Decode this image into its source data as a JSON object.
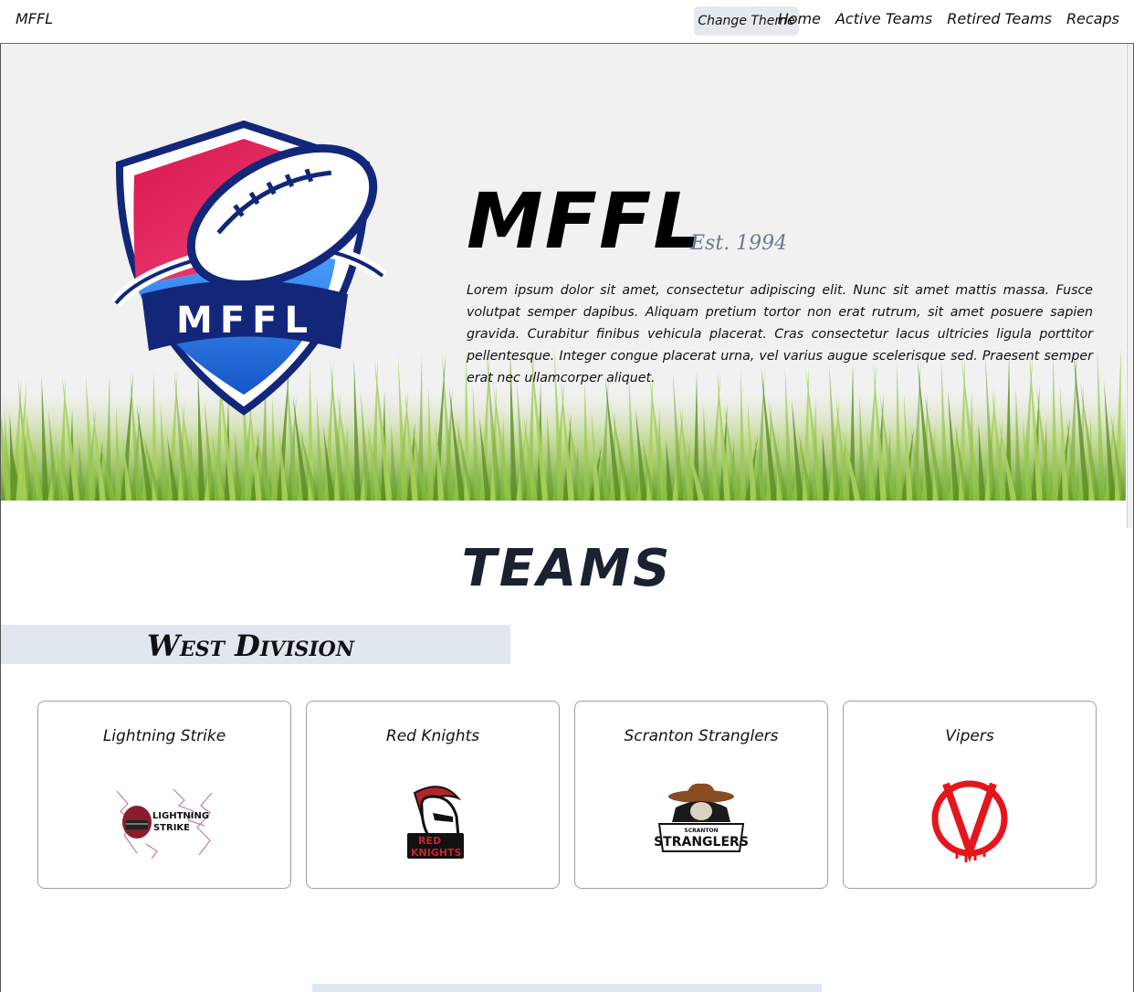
{
  "nav": {
    "brand": "MFFL",
    "theme_button": "Change Theme",
    "links": [
      "Home",
      "Active Teams",
      "Retired Teams",
      "Recaps"
    ]
  },
  "hero": {
    "logo_text": "MFFL",
    "title": "MFFL",
    "established": "Est. 1994",
    "description": "Lorem ipsum dolor sit amet, consectetur adipiscing elit. Nunc sit amet mattis massa. Fusce volutpat semper dapibus. Aliquam pretium tortor non erat rutrum, sit amet posuere sapien gravida. Curabitur finibus vehicula placerat. Cras consectetur lacus ultricies ligula porttitor pellentesque. Integer congue placerat urna, vel varius augue scelerisque sed. Praesent semper erat nec ullamcorper aliquet."
  },
  "teams": {
    "title": "TEAMS",
    "divisions": [
      {
        "name": "West Division",
        "teams": [
          {
            "name": "Lightning Strike",
            "logo_text": [
              "LIGHTNING",
              "STRIKE"
            ]
          },
          {
            "name": "Red Knights",
            "logo_text": [
              "RED",
              "KNIGHTS"
            ]
          },
          {
            "name": "Scranton Stranglers",
            "logo_text": [
              "SCRANTON",
              "STRANGLERS"
            ]
          },
          {
            "name": "Vipers",
            "logo_text": [
              "V"
            ]
          }
        ]
      }
    ]
  },
  "colors": {
    "shield_red": "#e0245e",
    "shield_blue": "#1f74e8",
    "navy": "#12277a",
    "division_bg": "#e1e7ef",
    "est_text": "#6b7a94"
  }
}
